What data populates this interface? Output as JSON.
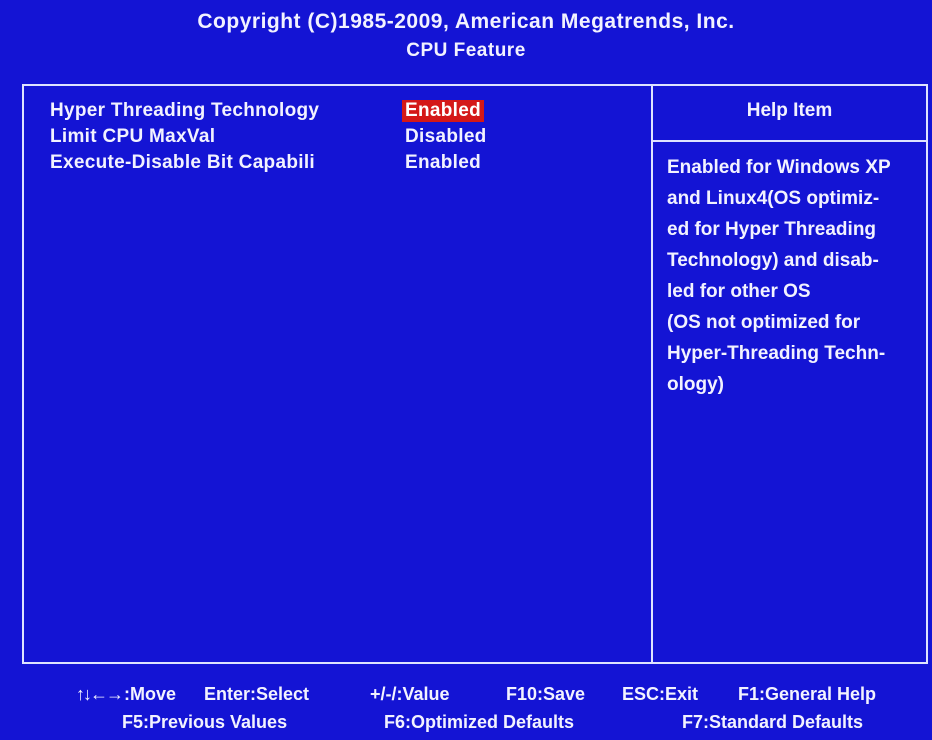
{
  "header": {
    "copyright": "Copyright (C)1985-2009, American Megatrends, Inc.",
    "page_title": "CPU Feature"
  },
  "settings": [
    {
      "label": "Hyper Threading Technology",
      "value": "Enabled"
    },
    {
      "label": "Limit CPU MaxVal",
      "value": "Disabled"
    },
    {
      "label": "Execute-Disable Bit Capabili",
      "value": "Enabled"
    }
  ],
  "help": {
    "title": "Help Item",
    "lines": [
      "Enabled for Windows XP",
      "and Linux4(OS optimiz-",
      "ed for Hyper Threading",
      "Technology) and disab-",
      "led for other OS",
      "(OS not optimized for",
      "Hyper-Threading Techn-",
      "ology)"
    ]
  },
  "footer": {
    "row1": {
      "arrows_icon": "↑↓←→",
      "move": ":Move",
      "enter": "Enter:Select",
      "value": "+/-/:Value",
      "save": "F10:Save",
      "exit": "ESC:Exit",
      "help": "F1:General Help"
    },
    "row2": {
      "previous": "F5:Previous Values",
      "optimized": "F6:Optimized Defaults",
      "standard": "F7:Standard Defaults"
    }
  },
  "colors": {
    "background": "#1414d4",
    "text": "#f2f2ff",
    "selection": "#d41818",
    "border": "#dfe3ff"
  },
  "state": {
    "selected_setting": "Hyper Threading Technology"
  }
}
